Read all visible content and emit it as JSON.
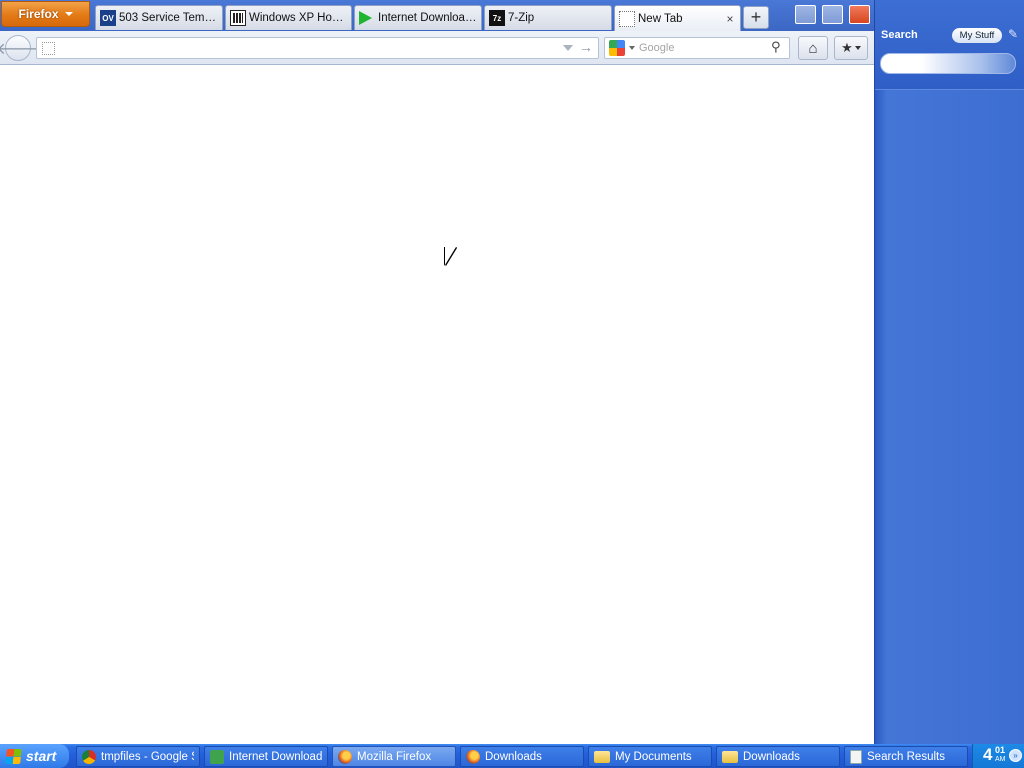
{
  "firefox": {
    "menu_label": "Firefox",
    "tabs": [
      {
        "label": "503 Service Tempo...",
        "icon": "ov-favicon-icon",
        "icon_text": "OV"
      },
      {
        "label": "Windows XP Home ...",
        "icon": "wikipedia-favicon-icon"
      },
      {
        "label": "Internet Download ...",
        "icon": "play-favicon-icon"
      },
      {
        "label": "7-Zip",
        "icon": "7zip-favicon-icon",
        "icon_text": "7z"
      },
      {
        "label": "New Tab",
        "icon": "blank-page-icon",
        "close": "×"
      }
    ],
    "new_tab_symbol": "+",
    "nav": {
      "back_symbol": "🡐",
      "url_value": "",
      "go_symbol": "→",
      "search_placeholder": "Google",
      "search_icon_symbol": "⚲",
      "home_symbol": "⌂",
      "bookmarks_symbol": "★"
    }
  },
  "sidebar": {
    "title": "Search",
    "my_stuff_label": "My Stuff",
    "pin_symbol": "✎",
    "search_value": ""
  },
  "taskbar": {
    "start_label": "start",
    "items": [
      {
        "label": "tmpfiles - Google Se",
        "icon": "chrome-icon"
      },
      {
        "label": "Internet Download M",
        "icon": "idm-icon"
      },
      {
        "label": "Mozilla Firefox",
        "icon": "firefox-icon",
        "active": true
      },
      {
        "label": "Downloads",
        "icon": "firefox-icon"
      },
      {
        "label": "My Documents",
        "icon": "folder-icon"
      },
      {
        "label": "Downloads",
        "icon": "folder-icon"
      },
      {
        "label": "Search Results",
        "icon": "search-results-icon"
      }
    ],
    "clock": {
      "hour": "4",
      "minutes": "01",
      "ampm": "AM"
    },
    "tray_expand_symbol": "»"
  },
  "colors": {
    "firefox_button": "#e27a16",
    "taskbar": "#245edb",
    "sidebar": "#3d6dd0",
    "close_button": "#d8461f"
  }
}
